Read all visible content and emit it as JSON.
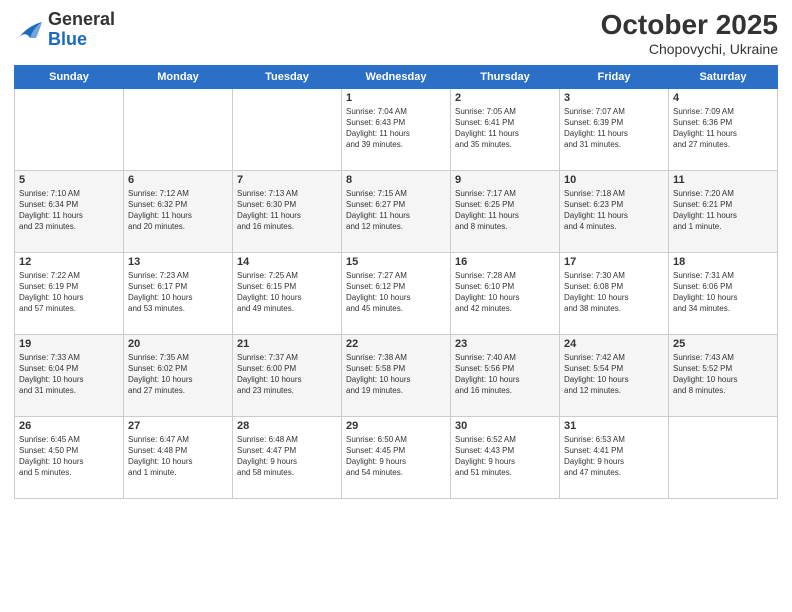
{
  "logo": {
    "general": "General",
    "blue": "Blue"
  },
  "title": "October 2025",
  "subtitle": "Chopovychi, Ukraine",
  "days_of_week": [
    "Sunday",
    "Monday",
    "Tuesday",
    "Wednesday",
    "Thursday",
    "Friday",
    "Saturday"
  ],
  "weeks": [
    [
      {
        "day": "",
        "info": ""
      },
      {
        "day": "",
        "info": ""
      },
      {
        "day": "",
        "info": ""
      },
      {
        "day": "1",
        "info": "Sunrise: 7:04 AM\nSunset: 6:43 PM\nDaylight: 11 hours\nand 39 minutes."
      },
      {
        "day": "2",
        "info": "Sunrise: 7:05 AM\nSunset: 6:41 PM\nDaylight: 11 hours\nand 35 minutes."
      },
      {
        "day": "3",
        "info": "Sunrise: 7:07 AM\nSunset: 6:39 PM\nDaylight: 11 hours\nand 31 minutes."
      },
      {
        "day": "4",
        "info": "Sunrise: 7:09 AM\nSunset: 6:36 PM\nDaylight: 11 hours\nand 27 minutes."
      }
    ],
    [
      {
        "day": "5",
        "info": "Sunrise: 7:10 AM\nSunset: 6:34 PM\nDaylight: 11 hours\nand 23 minutes."
      },
      {
        "day": "6",
        "info": "Sunrise: 7:12 AM\nSunset: 6:32 PM\nDaylight: 11 hours\nand 20 minutes."
      },
      {
        "day": "7",
        "info": "Sunrise: 7:13 AM\nSunset: 6:30 PM\nDaylight: 11 hours\nand 16 minutes."
      },
      {
        "day": "8",
        "info": "Sunrise: 7:15 AM\nSunset: 6:27 PM\nDaylight: 11 hours\nand 12 minutes."
      },
      {
        "day": "9",
        "info": "Sunrise: 7:17 AM\nSunset: 6:25 PM\nDaylight: 11 hours\nand 8 minutes."
      },
      {
        "day": "10",
        "info": "Sunrise: 7:18 AM\nSunset: 6:23 PM\nDaylight: 11 hours\nand 4 minutes."
      },
      {
        "day": "11",
        "info": "Sunrise: 7:20 AM\nSunset: 6:21 PM\nDaylight: 11 hours\nand 1 minute."
      }
    ],
    [
      {
        "day": "12",
        "info": "Sunrise: 7:22 AM\nSunset: 6:19 PM\nDaylight: 10 hours\nand 57 minutes."
      },
      {
        "day": "13",
        "info": "Sunrise: 7:23 AM\nSunset: 6:17 PM\nDaylight: 10 hours\nand 53 minutes."
      },
      {
        "day": "14",
        "info": "Sunrise: 7:25 AM\nSunset: 6:15 PM\nDaylight: 10 hours\nand 49 minutes."
      },
      {
        "day": "15",
        "info": "Sunrise: 7:27 AM\nSunset: 6:12 PM\nDaylight: 10 hours\nand 45 minutes."
      },
      {
        "day": "16",
        "info": "Sunrise: 7:28 AM\nSunset: 6:10 PM\nDaylight: 10 hours\nand 42 minutes."
      },
      {
        "day": "17",
        "info": "Sunrise: 7:30 AM\nSunset: 6:08 PM\nDaylight: 10 hours\nand 38 minutes."
      },
      {
        "day": "18",
        "info": "Sunrise: 7:31 AM\nSunset: 6:06 PM\nDaylight: 10 hours\nand 34 minutes."
      }
    ],
    [
      {
        "day": "19",
        "info": "Sunrise: 7:33 AM\nSunset: 6:04 PM\nDaylight: 10 hours\nand 31 minutes."
      },
      {
        "day": "20",
        "info": "Sunrise: 7:35 AM\nSunset: 6:02 PM\nDaylight: 10 hours\nand 27 minutes."
      },
      {
        "day": "21",
        "info": "Sunrise: 7:37 AM\nSunset: 6:00 PM\nDaylight: 10 hours\nand 23 minutes."
      },
      {
        "day": "22",
        "info": "Sunrise: 7:38 AM\nSunset: 5:58 PM\nDaylight: 10 hours\nand 19 minutes."
      },
      {
        "day": "23",
        "info": "Sunrise: 7:40 AM\nSunset: 5:56 PM\nDaylight: 10 hours\nand 16 minutes."
      },
      {
        "day": "24",
        "info": "Sunrise: 7:42 AM\nSunset: 5:54 PM\nDaylight: 10 hours\nand 12 minutes."
      },
      {
        "day": "25",
        "info": "Sunrise: 7:43 AM\nSunset: 5:52 PM\nDaylight: 10 hours\nand 8 minutes."
      }
    ],
    [
      {
        "day": "26",
        "info": "Sunrise: 6:45 AM\nSunset: 4:50 PM\nDaylight: 10 hours\nand 5 minutes."
      },
      {
        "day": "27",
        "info": "Sunrise: 6:47 AM\nSunset: 4:48 PM\nDaylight: 10 hours\nand 1 minute."
      },
      {
        "day": "28",
        "info": "Sunrise: 6:48 AM\nSunset: 4:47 PM\nDaylight: 9 hours\nand 58 minutes."
      },
      {
        "day": "29",
        "info": "Sunrise: 6:50 AM\nSunset: 4:45 PM\nDaylight: 9 hours\nand 54 minutes."
      },
      {
        "day": "30",
        "info": "Sunrise: 6:52 AM\nSunset: 4:43 PM\nDaylight: 9 hours\nand 51 minutes."
      },
      {
        "day": "31",
        "info": "Sunrise: 6:53 AM\nSunset: 4:41 PM\nDaylight: 9 hours\nand 47 minutes."
      },
      {
        "day": "",
        "info": ""
      }
    ]
  ]
}
